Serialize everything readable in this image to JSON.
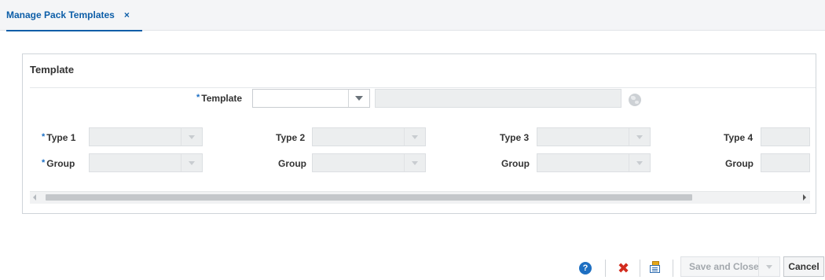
{
  "tab": {
    "label": "Manage Pack Templates",
    "close": "×"
  },
  "panel": {
    "title": "Template",
    "template_label": "Template",
    "required_mark": "*"
  },
  "types": [
    {
      "type_label": "Type 1",
      "group_label": "Group",
      "required": true
    },
    {
      "type_label": "Type 2",
      "group_label": "Group",
      "required": false
    },
    {
      "type_label": "Type 3",
      "group_label": "Group",
      "required": false
    },
    {
      "type_label": "Type 4",
      "group_label": "Group",
      "required": false
    }
  ],
  "footer": {
    "help_glyph": "?",
    "delete_glyph": "✖",
    "save_close_label": "Save and Close",
    "cancel_label": "Cancel"
  },
  "icons": [
    "help-icon",
    "delete-icon",
    "import-icon",
    "globe-icon",
    "chevron-down-icon"
  ],
  "colors": {
    "accent": "#0d5ea8",
    "required": "#1a6ec4",
    "delete": "#d22b1e"
  }
}
